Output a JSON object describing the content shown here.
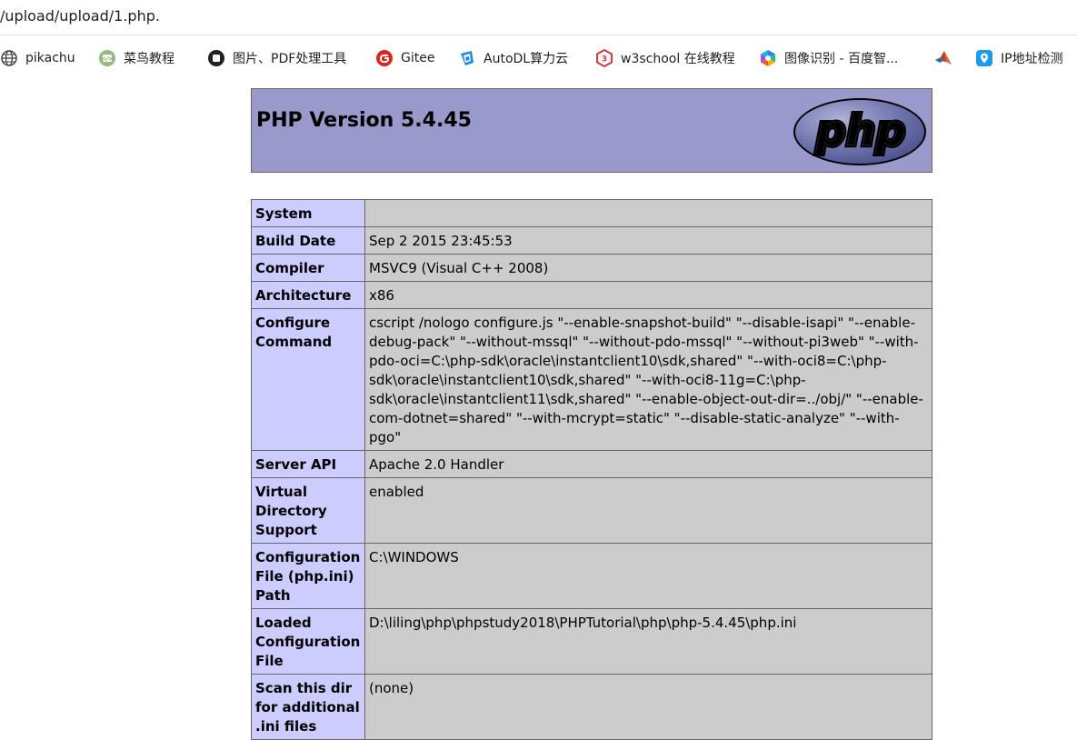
{
  "browser": {
    "url": "/upload/upload/1.php.",
    "bookmarks": [
      {
        "label": "pikachu",
        "icon": "globe-icon"
      },
      {
        "label": "菜鸟教程",
        "icon": "runoob-icon"
      },
      {
        "label": "图片、PDF处理工具",
        "icon": "square-app-icon"
      },
      {
        "label": "Gitee",
        "icon": "gitee-icon"
      },
      {
        "label": "AutoDL算力云",
        "icon": "autodl-icon"
      },
      {
        "label": "w3school 在线教程",
        "icon": "w3school-icon"
      },
      {
        "label": "图像识别 - 百度智...",
        "icon": "baidu-ai-icon"
      },
      {
        "label": "",
        "icon": "matlab-icon"
      },
      {
        "label": "IP地址检测",
        "icon": "ip-location-icon"
      }
    ]
  },
  "phpinfo": {
    "title": "PHP Version 5.4.45",
    "logo_text": "php",
    "colors": {
      "header_bg": "#9999cc",
      "key_bg": "#ccccff",
      "value_bg": "#cccccc",
      "border": "#666666"
    },
    "rows": [
      {
        "key": "System",
        "value": ""
      },
      {
        "key": "Build Date",
        "value": "Sep 2 2015 23:45:53"
      },
      {
        "key": "Compiler",
        "value": "MSVC9 (Visual C++ 2008)"
      },
      {
        "key": "Architecture",
        "value": "x86"
      },
      {
        "key": "Configure Command",
        "value": "cscript /nologo configure.js \"--enable-snapshot-build\" \"--disable-isapi\" \"--enable-debug-pack\" \"--without-mssql\" \"--without-pdo-mssql\" \"--without-pi3web\" \"--with-pdo-oci=C:\\php-sdk\\oracle\\instantclient10\\sdk,shared\" \"--with-oci8=C:\\php-sdk\\oracle\\instantclient10\\sdk,shared\" \"--with-oci8-11g=C:\\php-sdk\\oracle\\instantclient11\\sdk,shared\" \"--enable-object-out-dir=../obj/\" \"--enable-com-dotnet=shared\" \"--with-mcrypt=static\" \"--disable-static-analyze\" \"--with-pgo\""
      },
      {
        "key": "Server API",
        "value": "Apache 2.0 Handler"
      },
      {
        "key": "Virtual Directory Support",
        "value": "enabled"
      },
      {
        "key": "Configuration File (php.ini) Path",
        "value": "C:\\WINDOWS"
      },
      {
        "key": "Loaded Configuration File",
        "value": "D:\\liling\\php\\phpstudy2018\\PHPTutorial\\php\\php-5.4.45\\php.ini"
      },
      {
        "key": "Scan this dir for additional .ini files",
        "value": "(none)"
      }
    ]
  }
}
